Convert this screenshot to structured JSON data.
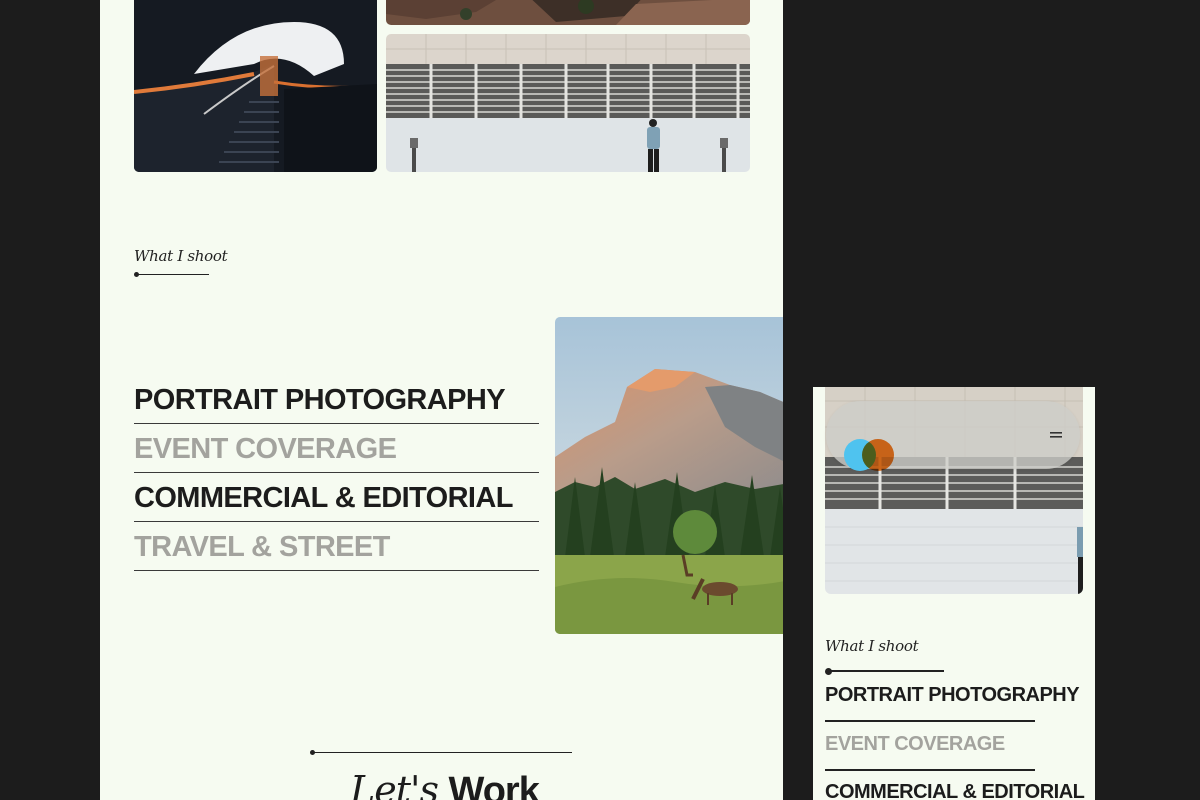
{
  "desktop": {
    "section_label": "What I shoot",
    "services": [
      {
        "label": "PORTRAIT PHOTOGRAPHY",
        "state": "active"
      },
      {
        "label": "EVENT COVERAGE",
        "state": "muted"
      },
      {
        "label": "COMMERCIAL & EDITORIAL",
        "state": "active"
      },
      {
        "label": "TRAVEL & STREET",
        "state": "muted"
      }
    ],
    "cta": {
      "italic": "Let's",
      "bold": "Work"
    }
  },
  "mobile": {
    "section_label": "What I shoot",
    "services": [
      {
        "label": "PORTRAIT PHOTOGRAPHY",
        "state": "active"
      },
      {
        "label": "EVENT COVERAGE",
        "state": "muted"
      },
      {
        "label": "COMMERCIAL & EDITORIAL",
        "state": "active"
      }
    ],
    "icons": {
      "logo": "overlapping-circles-logo",
      "menu": "hamburger-menu-icon"
    }
  },
  "colors": {
    "page_background": "#1c1c1c",
    "canvas": "#f6fbf1",
    "text_dark": "#1c1c1c",
    "text_muted": "#a3a39e",
    "logo_blue": "#4fc3ef",
    "logo_orange": "#f57a1f"
  }
}
